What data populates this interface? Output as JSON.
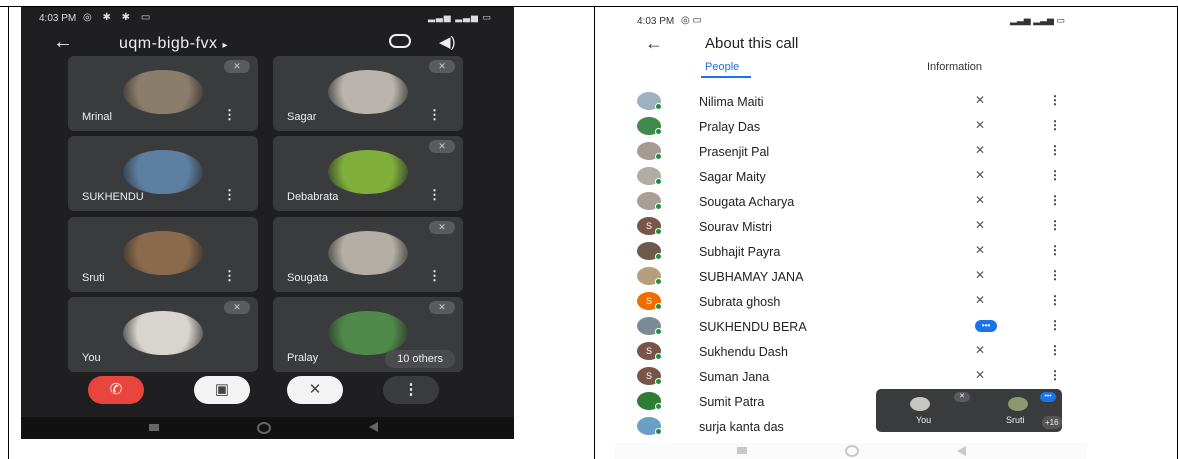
{
  "left": {
    "status": {
      "time": "4:03 PM"
    },
    "meeting_code": "uqm-bigb-fvx",
    "tiles": [
      {
        "name": "Mrinal",
        "avatar_color": "#8b7d6b"
      },
      {
        "name": "Sagar",
        "avatar_color": "#b9b4ad"
      },
      {
        "name": "SUKHENDU",
        "avatar_color": "#5d7fa0"
      },
      {
        "name": "Debabrata",
        "avatar_color": "#7fae3a"
      },
      {
        "name": "Sruti",
        "avatar_color": "#8a6a4c"
      },
      {
        "name": "Sougata",
        "avatar_color": "#b3aea6"
      },
      {
        "name": "You",
        "avatar_color": "#d8d4cf"
      },
      {
        "name": "Pralay",
        "avatar_color": "#4f8a4a"
      }
    ],
    "others_label": "10 others",
    "colors": {
      "end_call": "#e8453c",
      "tile": "#3a3b3d",
      "background": "#1f1f21"
    }
  },
  "right": {
    "status": {
      "time": "4:03 PM"
    },
    "title": "About this call",
    "tabs": [
      "People",
      "Information"
    ],
    "people": [
      {
        "name": "Nilima Maiti",
        "initial": "",
        "color": "#9fb0c2",
        "state": "muted"
      },
      {
        "name": "Pralay Das",
        "initial": "",
        "color": "#3f8a4a",
        "state": "muted"
      },
      {
        "name": "Prasenjit Pal",
        "initial": "",
        "color": "#a59b94",
        "state": "muted"
      },
      {
        "name": "Sagar Maity",
        "initial": "",
        "color": "#b1aca4",
        "state": "muted"
      },
      {
        "name": "Sougata Acharya",
        "initial": "",
        "color": "#a89f99",
        "state": "muted"
      },
      {
        "name": "Sourav Mistri",
        "initial": "S",
        "color": "#795548",
        "state": "muted"
      },
      {
        "name": "Subhajit Payra",
        "initial": "",
        "color": "#6d5a4a",
        "state": "muted"
      },
      {
        "name": "SUBHAMAY JANA",
        "initial": "",
        "color": "#b59f7d",
        "state": "muted"
      },
      {
        "name": "Subrata ghosh",
        "initial": "S",
        "color": "#ef6c00",
        "state": "muted"
      },
      {
        "name": "SUKHENDU BERA",
        "initial": "",
        "color": "#7c8a98",
        "state": "speaking"
      },
      {
        "name": "Sukhendu Dash",
        "initial": "S",
        "color": "#795548",
        "state": "muted"
      },
      {
        "name": "Suman Jana",
        "initial": "S",
        "color": "#795548",
        "state": "muted"
      },
      {
        "name": "Sumit Patra",
        "initial": "",
        "color": "#2e7d32",
        "state": "none"
      },
      {
        "name": "surja kanta das",
        "initial": "",
        "color": "#6aa0c8",
        "state": "none"
      }
    ],
    "pip": {
      "you_label": "You",
      "other_label": "Sruti",
      "count": "+16"
    },
    "colors": {
      "accent": "#1a73e8",
      "online_dot": "#1e8e3e"
    }
  },
  "icons": {
    "back": "←",
    "dropdown": "▸",
    "speaker": "🔊",
    "mic_off": "🎙",
    "more": "⋮",
    "end_call": "☎",
    "cam_off": "▣",
    "speaking": "•••"
  }
}
